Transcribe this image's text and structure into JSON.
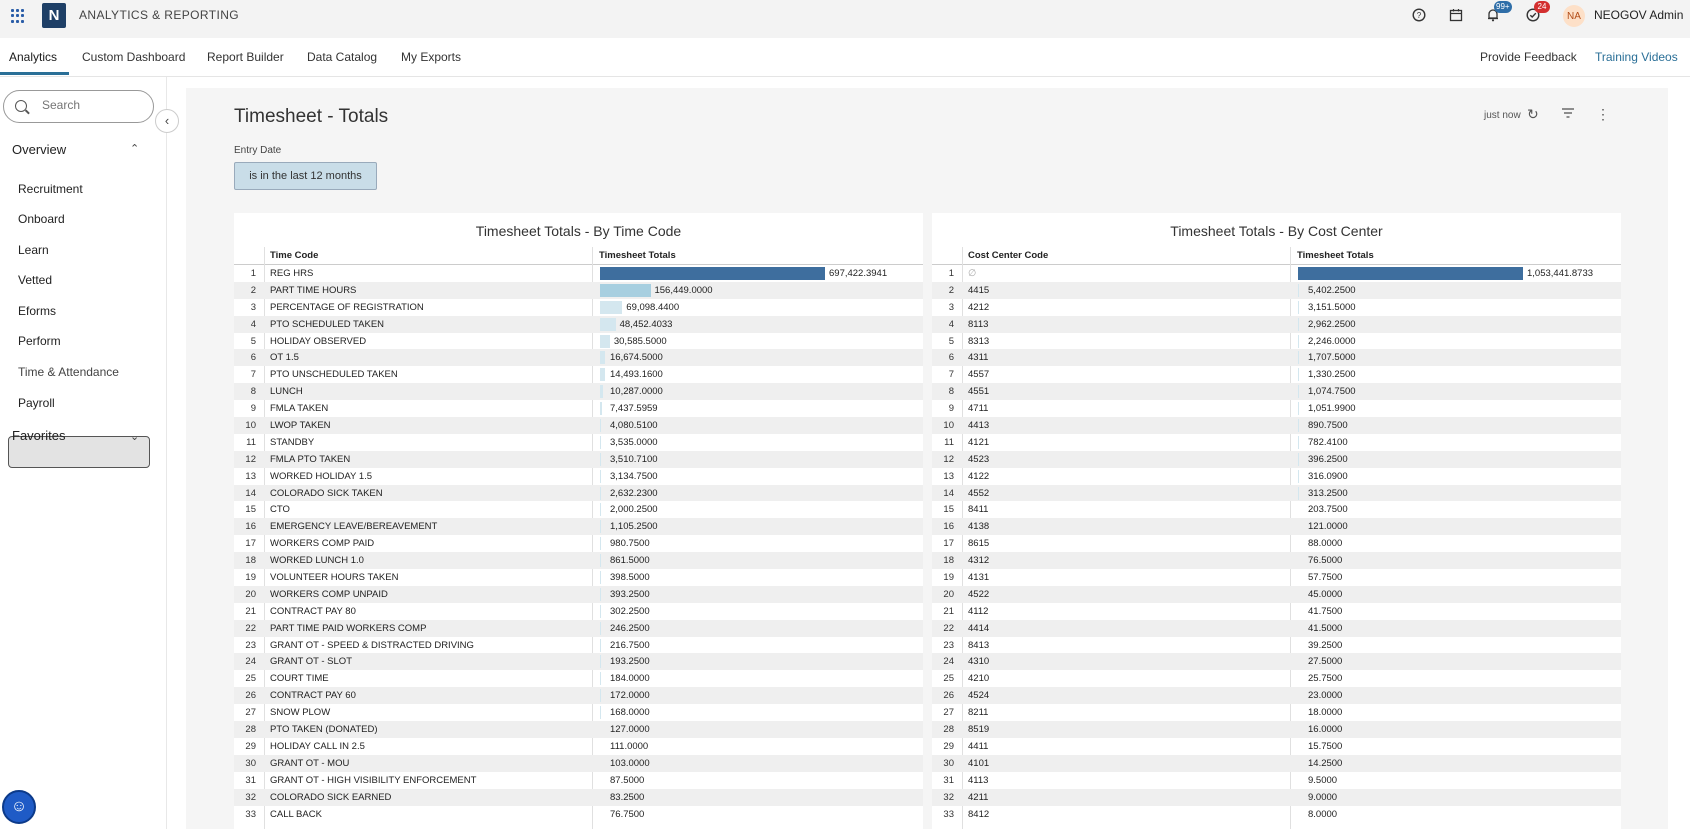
{
  "header": {
    "app_title": "ANALYTICS & REPORTING",
    "logo_letter": "N",
    "notif_badge": "99+",
    "tasks_badge": "24",
    "avatar_initials": "NA",
    "user_name": "NEOGOV Admin"
  },
  "nav": {
    "tabs": [
      "Analytics",
      "Custom Dashboard",
      "Report Builder",
      "Data Catalog",
      "My Exports"
    ],
    "feedback": "Provide Feedback",
    "training": "Training Videos"
  },
  "sidebar": {
    "search_placeholder": "Search",
    "overview": "Overview",
    "items": [
      "Recruitment",
      "Onboard",
      "Learn",
      "Vetted",
      "Eforms",
      "Perform",
      "Time & Attendance",
      "Payroll"
    ],
    "active_item": "Time & Attendance",
    "favorites": "Favorites"
  },
  "page": {
    "title": "Timesheet - Totals",
    "refresh_time": "just now",
    "filter_label": "Entry Date",
    "filter_value": "is in the last 12 months"
  },
  "colors": {
    "bar_dark": "#3e6e9e",
    "bar_mid": "#a7cfe0",
    "bar_light": "#d4e7ef",
    "accent": "#2a6f97"
  },
  "chart_data": [
    {
      "type": "table",
      "title": "Timesheet Totals - By Time Code",
      "columns": [
        "Time Code",
        "Timesheet Totals"
      ],
      "rows": [
        [
          "1",
          "REG HRS",
          "697,422.3941"
        ],
        [
          "2",
          "PART TIME HOURS",
          "156,449.0000"
        ],
        [
          "3",
          "PERCENTAGE OF REGISTRATION",
          "69,098.4400"
        ],
        [
          "4",
          "PTO SCHEDULED TAKEN",
          "48,452.4033"
        ],
        [
          "5",
          "HOLIDAY OBSERVED",
          "30,585.5000"
        ],
        [
          "6",
          "OT 1.5",
          "16,674.5000"
        ],
        [
          "7",
          "PTO UNSCHEDULED TAKEN",
          "14,493.1600"
        ],
        [
          "8",
          "LUNCH",
          "10,287.0000"
        ],
        [
          "9",
          "FMLA TAKEN",
          "7,437.5959"
        ],
        [
          "10",
          "LWOP TAKEN",
          "4,080.5100"
        ],
        [
          "11",
          "STANDBY",
          "3,535.0000"
        ],
        [
          "12",
          "FMLA PTO TAKEN",
          "3,510.7100"
        ],
        [
          "13",
          "WORKED HOLIDAY 1.5",
          "3,134.7500"
        ],
        [
          "14",
          "COLORADO SICK TAKEN",
          "2,632.2300"
        ],
        [
          "15",
          "CTO",
          "2,000.2500"
        ],
        [
          "16",
          "EMERGENCY LEAVE/BEREAVEMENT",
          "1,105.2500"
        ],
        [
          "17",
          "WORKERS COMP PAID",
          "980.7500"
        ],
        [
          "18",
          "WORKED LUNCH 1.0",
          "861.5000"
        ],
        [
          "19",
          "VOLUNTEER HOURS TAKEN",
          "398.5000"
        ],
        [
          "20",
          "WORKERS COMP UNPAID",
          "393.2500"
        ],
        [
          "21",
          "CONTRACT PAY 80",
          "302.2500"
        ],
        [
          "22",
          "PART TIME PAID WORKERS COMP",
          "246.2500"
        ],
        [
          "23",
          "GRANT OT - SPEED & DISTRACTED DRIVING",
          "216.7500"
        ],
        [
          "24",
          "GRANT OT - SLOT",
          "193.2500"
        ],
        [
          "25",
          "COURT TIME",
          "184.0000"
        ],
        [
          "26",
          "CONTRACT PAY 60",
          "172.0000"
        ],
        [
          "27",
          "SNOW PLOW",
          "168.0000"
        ],
        [
          "28",
          "PTO TAKEN (DONATED)",
          "127.0000"
        ],
        [
          "29",
          "HOLIDAY CALL IN 2.5",
          "111.0000"
        ],
        [
          "30",
          "GRANT OT - MOU",
          "103.0000"
        ],
        [
          "31",
          "GRANT OT - HIGH VISIBILITY ENFORCEMENT",
          "87.5000"
        ],
        [
          "32",
          "COLORADO SICK EARNED",
          "83.2500"
        ],
        [
          "33",
          "CALL BACK",
          "76.7500"
        ]
      ],
      "values": [
        697422.3941,
        156449,
        69098.44,
        48452.4033,
        30585.5,
        16674.5,
        14493.16,
        10287,
        7437.5959,
        4080.51,
        3535,
        3510.71,
        3134.75,
        2632.23,
        2000.25,
        1105.25,
        980.75,
        861.5,
        398.5,
        393.25,
        302.25,
        246.25,
        216.75,
        193.25,
        184,
        172,
        168,
        127,
        111,
        103,
        87.5,
        83.25,
        76.75
      ]
    },
    {
      "type": "table",
      "title": "Timesheet Totals - By Cost Center",
      "columns": [
        "Cost Center Code",
        "Timesheet Totals"
      ],
      "rows": [
        [
          "1",
          "∅",
          "1,053,441.8733"
        ],
        [
          "2",
          "4415",
          "5,402.2500"
        ],
        [
          "3",
          "4212",
          "3,151.5000"
        ],
        [
          "4",
          "8113",
          "2,962.2500"
        ],
        [
          "5",
          "8313",
          "2,246.0000"
        ],
        [
          "6",
          "4311",
          "1,707.5000"
        ],
        [
          "7",
          "4557",
          "1,330.2500"
        ],
        [
          "8",
          "4551",
          "1,074.7500"
        ],
        [
          "9",
          "4711",
          "1,051.9900"
        ],
        [
          "10",
          "4413",
          "890.7500"
        ],
        [
          "11",
          "4121",
          "782.4100"
        ],
        [
          "12",
          "4523",
          "396.2500"
        ],
        [
          "13",
          "4122",
          "316.0900"
        ],
        [
          "14",
          "4552",
          "313.2500"
        ],
        [
          "15",
          "8411",
          "203.7500"
        ],
        [
          "16",
          "4138",
          "121.0000"
        ],
        [
          "17",
          "8615",
          "88.0000"
        ],
        [
          "18",
          "4312",
          "76.5000"
        ],
        [
          "19",
          "4131",
          "57.7500"
        ],
        [
          "20",
          "4522",
          "45.0000"
        ],
        [
          "21",
          "4112",
          "41.7500"
        ],
        [
          "22",
          "4414",
          "41.5000"
        ],
        [
          "23",
          "8413",
          "39.2500"
        ],
        [
          "24",
          "4310",
          "27.5000"
        ],
        [
          "25",
          "4210",
          "25.7500"
        ],
        [
          "26",
          "4524",
          "23.0000"
        ],
        [
          "27",
          "8211",
          "18.0000"
        ],
        [
          "28",
          "8519",
          "16.0000"
        ],
        [
          "29",
          "4411",
          "15.7500"
        ],
        [
          "30",
          "4101",
          "14.2500"
        ],
        [
          "31",
          "4113",
          "9.5000"
        ],
        [
          "32",
          "4211",
          "9.0000"
        ],
        [
          "33",
          "8412",
          "8.0000"
        ]
      ],
      "values": [
        1053441.8733,
        5402.25,
        3151.5,
        2962.25,
        2246,
        1707.5,
        1330.25,
        1074.75,
        1051.99,
        890.75,
        782.41,
        396.25,
        316.09,
        313.25,
        203.75,
        121,
        88,
        76.5,
        57.75,
        45,
        41.75,
        41.5,
        39.25,
        27.5,
        25.75,
        23,
        18,
        16,
        15.75,
        14.25,
        9.5,
        9,
        8
      ]
    }
  ]
}
